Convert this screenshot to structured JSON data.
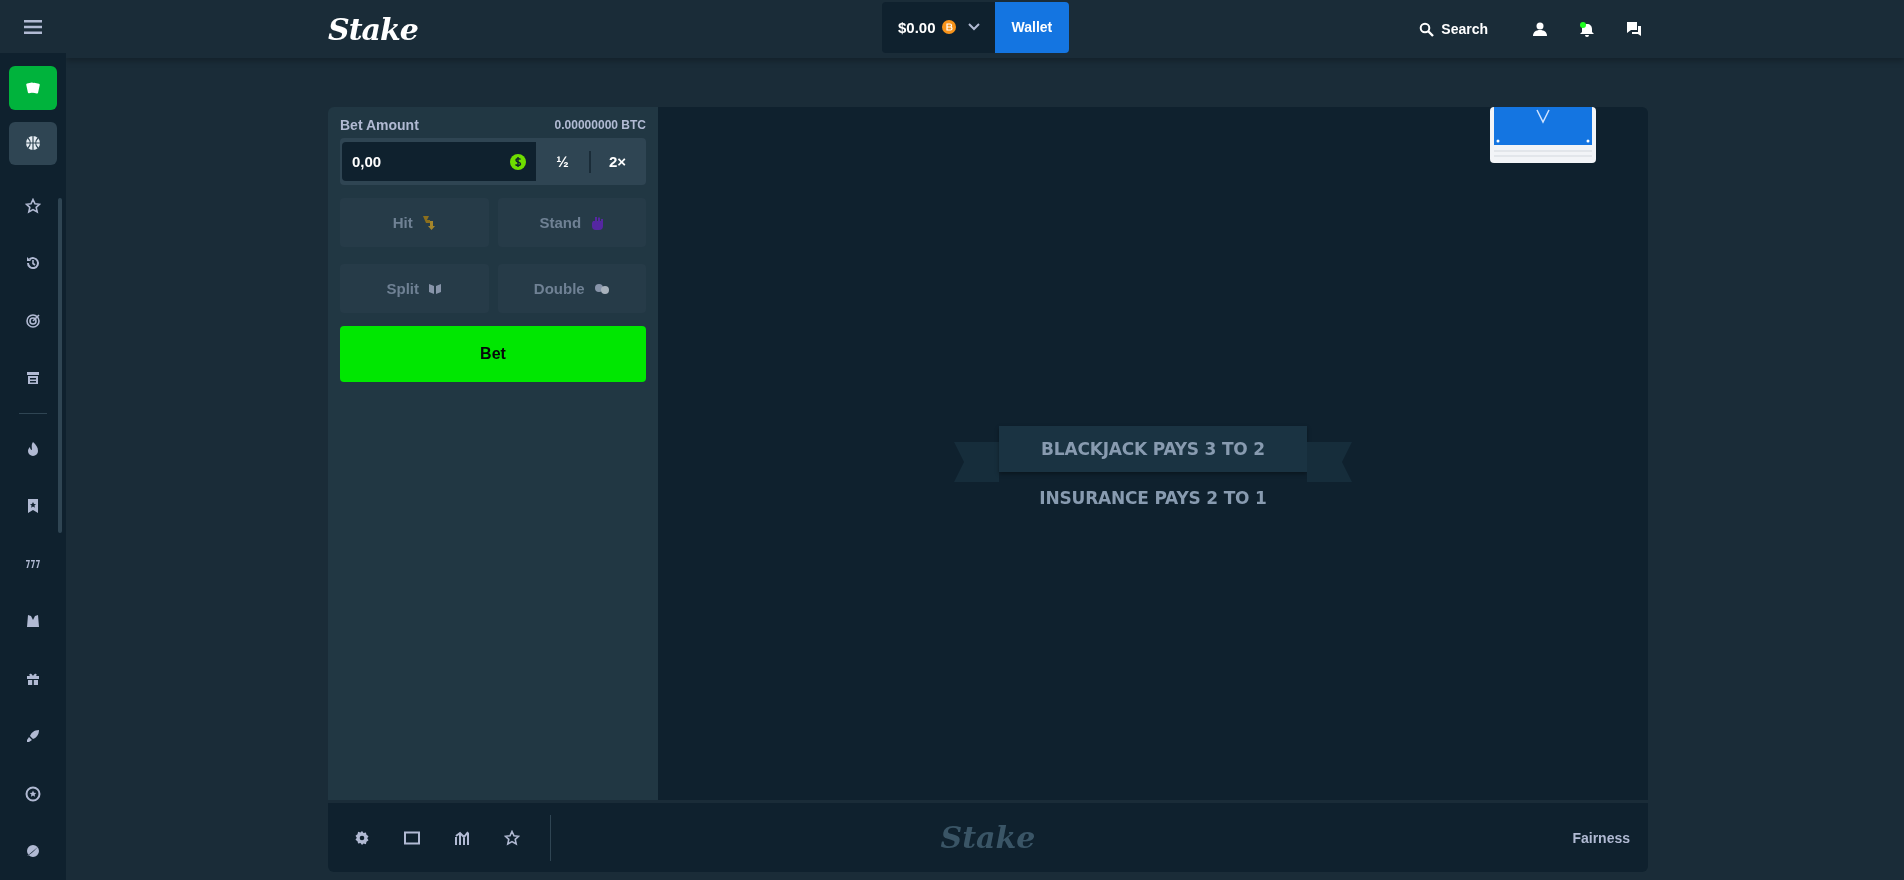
{
  "topbar": {
    "logo": "Stake",
    "balance": "$0.00",
    "wallet_button": "Wallet",
    "search_label": "Search"
  },
  "sidebar": {
    "tiles": [
      {
        "kind": "casino",
        "selected": true
      },
      {
        "kind": "sports",
        "selected": false
      }
    ]
  },
  "bet_panel": {
    "label": "Bet Amount",
    "crypto_amount": "0.00000000 BTC",
    "amount_value": "0,00",
    "half_button": "½",
    "double_button": "2×",
    "actions": [
      {
        "kind": "hit",
        "label": "Hit",
        "disabled": true
      },
      {
        "kind": "stand",
        "label": "Stand",
        "disabled": true
      },
      {
        "kind": "split",
        "label": "Split",
        "disabled": true
      },
      {
        "kind": "double",
        "label": "Double",
        "disabled": true
      }
    ],
    "bet_button": "Bet"
  },
  "table": {
    "banner": "BLACKJACK PAYS 3 TO 2",
    "subtitle": "INSURANCE PAYS 2 TO 1"
  },
  "footer": {
    "logo": "Stake",
    "fairness_link": "Fairness"
  }
}
